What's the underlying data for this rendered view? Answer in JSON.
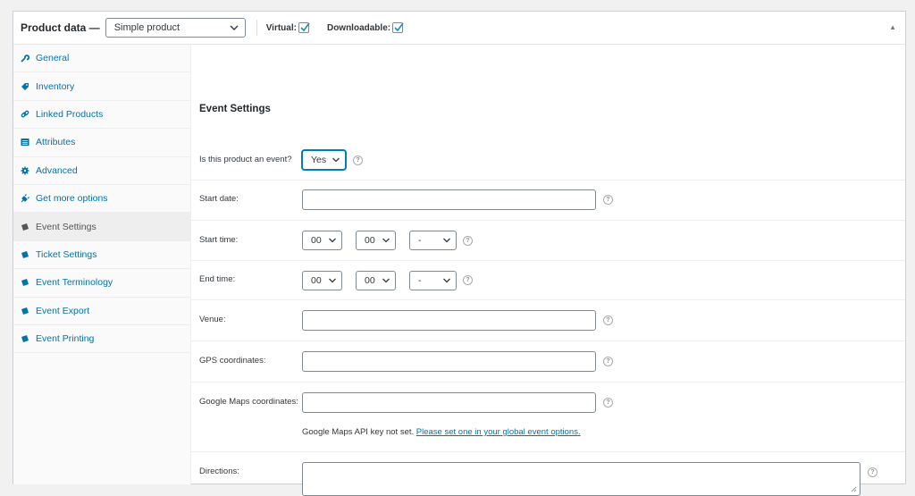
{
  "header": {
    "title": "Product data —",
    "product_type": "Simple product",
    "virtual_label": "Virtual:",
    "downloadable_label": "Downloadable:",
    "toggle_icon": "triangle-up-icon"
  },
  "tabs": [
    {
      "label": "General",
      "icon": "wrench-icon"
    },
    {
      "label": "Inventory",
      "icon": "tag-icon"
    },
    {
      "label": "Linked Products",
      "icon": "link-icon"
    },
    {
      "label": "Attributes",
      "icon": "list-icon"
    },
    {
      "label": "Advanced",
      "icon": "gear-icon"
    },
    {
      "label": "Get more options",
      "icon": "plugin-icon"
    },
    {
      "label": "Event Settings",
      "icon": "ticket-icon"
    },
    {
      "label": "Ticket Settings",
      "icon": "ticket-icon"
    },
    {
      "label": "Event Terminology",
      "icon": "ticket-icon"
    },
    {
      "label": "Event Export",
      "icon": "ticket-icon"
    },
    {
      "label": "Event Printing",
      "icon": "ticket-icon"
    }
  ],
  "main": {
    "section_title": "Event Settings",
    "is_event_label": "Is this product an event?",
    "is_event_value": "Yes",
    "start_date_label": "Start date:",
    "start_time_label": "Start time:",
    "start_hour": "00",
    "start_minute": "00",
    "start_period": "-",
    "end_time_label": "End time:",
    "end_hour": "00",
    "end_minute": "00",
    "end_period": "-",
    "venue_label": "Venue:",
    "gps_label": "GPS coordinates:",
    "google_maps_label": "Google Maps coordinates:",
    "maps_note": "Google Maps API key not set.",
    "maps_link": "Please set one in your global event options.",
    "directions_label": "Directions:",
    "help_glyph": "?"
  },
  "colors": {
    "link": "#0073aa",
    "accent": "#007cba"
  }
}
